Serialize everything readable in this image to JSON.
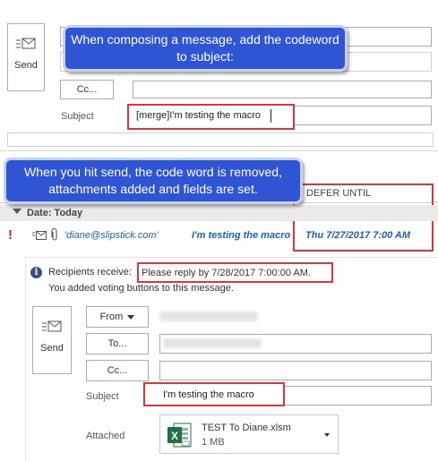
{
  "compose": {
    "send_label": "Send",
    "cc_label": "Cc...",
    "subject_label": "Subject",
    "subject_value": "[merge]I'm testing the macro"
  },
  "callouts": {
    "top": "When composing a message, add the codeword to subject:",
    "middle": "When you hit send, the code word is removed, attachments added and fields are set."
  },
  "outbox": {
    "column_header": "DEFER UNTIL",
    "group_label": "Date: Today",
    "row": {
      "importance": "!",
      "to": "'diane@slipstick.com'",
      "subject": "I'm testing the macro",
      "defer": "Thu 7/27/2017 7:00 AM"
    }
  },
  "sent": {
    "info_prefix": "Recipients receive:",
    "info_highlight": "Please reply by 7/28/2017 7:00:00 AM.",
    "info_line2": "You added voting buttons to this message.",
    "from_label": "From",
    "to_label": "To...",
    "cc_label": "Cc...",
    "send_label": "Send",
    "subject_label": "Subject",
    "subject_value": "I'm testing the macro",
    "attached_label": "Attached",
    "attachment_name": "TEST To Diane.xlsm",
    "attachment_size": "1 MB"
  },
  "colors": {
    "callout": "#2f55d4",
    "highlight": "#e0343c",
    "link": "#1f5fb0",
    "excel": "#1e7145"
  }
}
